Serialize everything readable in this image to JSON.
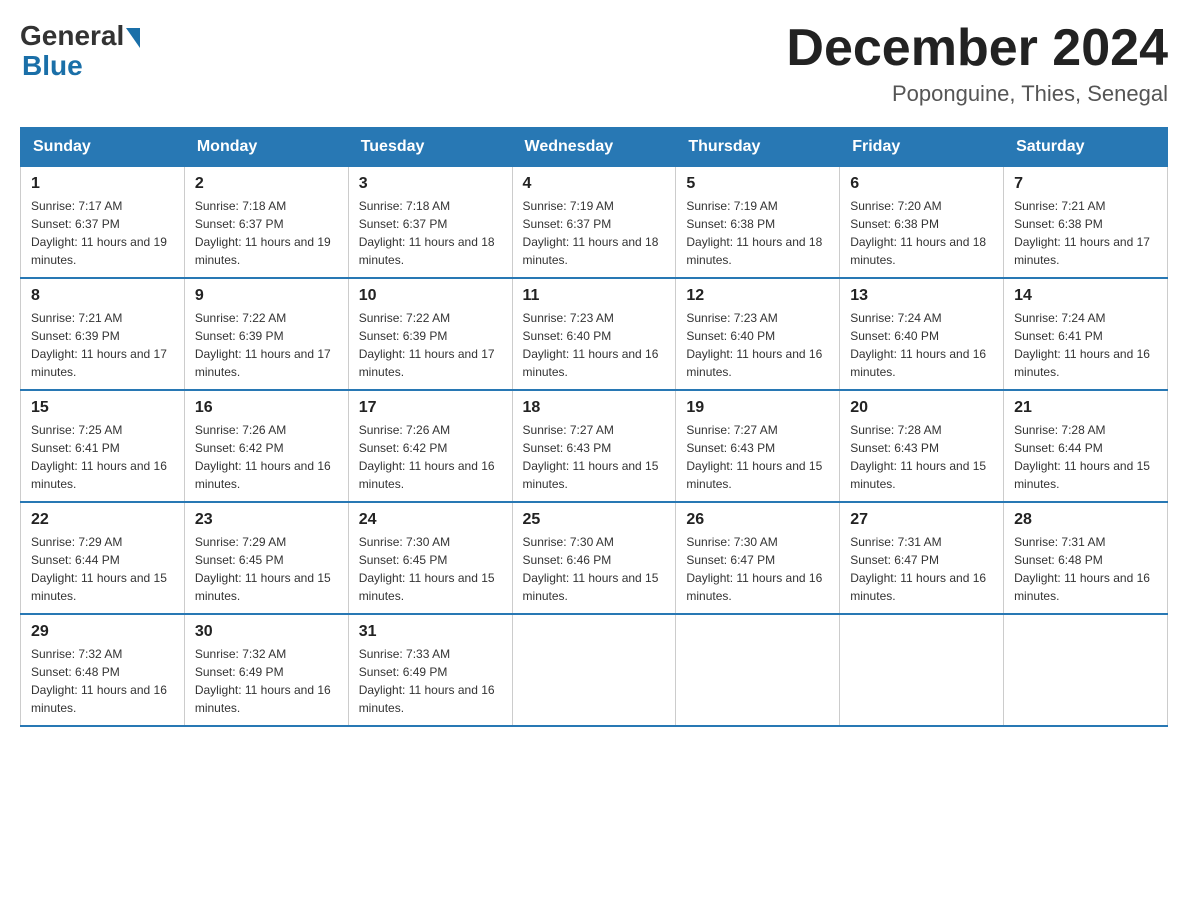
{
  "logo": {
    "general": "General",
    "blue": "Blue"
  },
  "title": "December 2024",
  "location": "Poponguine, Thies, Senegal",
  "days_header": [
    "Sunday",
    "Monday",
    "Tuesday",
    "Wednesday",
    "Thursday",
    "Friday",
    "Saturday"
  ],
  "weeks": [
    [
      {
        "day": "1",
        "sunrise": "7:17 AM",
        "sunset": "6:37 PM",
        "daylight": "11 hours and 19 minutes."
      },
      {
        "day": "2",
        "sunrise": "7:18 AM",
        "sunset": "6:37 PM",
        "daylight": "11 hours and 19 minutes."
      },
      {
        "day": "3",
        "sunrise": "7:18 AM",
        "sunset": "6:37 PM",
        "daylight": "11 hours and 18 minutes."
      },
      {
        "day": "4",
        "sunrise": "7:19 AM",
        "sunset": "6:37 PM",
        "daylight": "11 hours and 18 minutes."
      },
      {
        "day": "5",
        "sunrise": "7:19 AM",
        "sunset": "6:38 PM",
        "daylight": "11 hours and 18 minutes."
      },
      {
        "day": "6",
        "sunrise": "7:20 AM",
        "sunset": "6:38 PM",
        "daylight": "11 hours and 18 minutes."
      },
      {
        "day": "7",
        "sunrise": "7:21 AM",
        "sunset": "6:38 PM",
        "daylight": "11 hours and 17 minutes."
      }
    ],
    [
      {
        "day": "8",
        "sunrise": "7:21 AM",
        "sunset": "6:39 PM",
        "daylight": "11 hours and 17 minutes."
      },
      {
        "day": "9",
        "sunrise": "7:22 AM",
        "sunset": "6:39 PM",
        "daylight": "11 hours and 17 minutes."
      },
      {
        "day": "10",
        "sunrise": "7:22 AM",
        "sunset": "6:39 PM",
        "daylight": "11 hours and 17 minutes."
      },
      {
        "day": "11",
        "sunrise": "7:23 AM",
        "sunset": "6:40 PM",
        "daylight": "11 hours and 16 minutes."
      },
      {
        "day": "12",
        "sunrise": "7:23 AM",
        "sunset": "6:40 PM",
        "daylight": "11 hours and 16 minutes."
      },
      {
        "day": "13",
        "sunrise": "7:24 AM",
        "sunset": "6:40 PM",
        "daylight": "11 hours and 16 minutes."
      },
      {
        "day": "14",
        "sunrise": "7:24 AM",
        "sunset": "6:41 PM",
        "daylight": "11 hours and 16 minutes."
      }
    ],
    [
      {
        "day": "15",
        "sunrise": "7:25 AM",
        "sunset": "6:41 PM",
        "daylight": "11 hours and 16 minutes."
      },
      {
        "day": "16",
        "sunrise": "7:26 AM",
        "sunset": "6:42 PM",
        "daylight": "11 hours and 16 minutes."
      },
      {
        "day": "17",
        "sunrise": "7:26 AM",
        "sunset": "6:42 PM",
        "daylight": "11 hours and 16 minutes."
      },
      {
        "day": "18",
        "sunrise": "7:27 AM",
        "sunset": "6:43 PM",
        "daylight": "11 hours and 15 minutes."
      },
      {
        "day": "19",
        "sunrise": "7:27 AM",
        "sunset": "6:43 PM",
        "daylight": "11 hours and 15 minutes."
      },
      {
        "day": "20",
        "sunrise": "7:28 AM",
        "sunset": "6:43 PM",
        "daylight": "11 hours and 15 minutes."
      },
      {
        "day": "21",
        "sunrise": "7:28 AM",
        "sunset": "6:44 PM",
        "daylight": "11 hours and 15 minutes."
      }
    ],
    [
      {
        "day": "22",
        "sunrise": "7:29 AM",
        "sunset": "6:44 PM",
        "daylight": "11 hours and 15 minutes."
      },
      {
        "day": "23",
        "sunrise": "7:29 AM",
        "sunset": "6:45 PM",
        "daylight": "11 hours and 15 minutes."
      },
      {
        "day": "24",
        "sunrise": "7:30 AM",
        "sunset": "6:45 PM",
        "daylight": "11 hours and 15 minutes."
      },
      {
        "day": "25",
        "sunrise": "7:30 AM",
        "sunset": "6:46 PM",
        "daylight": "11 hours and 15 minutes."
      },
      {
        "day": "26",
        "sunrise": "7:30 AM",
        "sunset": "6:47 PM",
        "daylight": "11 hours and 16 minutes."
      },
      {
        "day": "27",
        "sunrise": "7:31 AM",
        "sunset": "6:47 PM",
        "daylight": "11 hours and 16 minutes."
      },
      {
        "day": "28",
        "sunrise": "7:31 AM",
        "sunset": "6:48 PM",
        "daylight": "11 hours and 16 minutes."
      }
    ],
    [
      {
        "day": "29",
        "sunrise": "7:32 AM",
        "sunset": "6:48 PM",
        "daylight": "11 hours and 16 minutes."
      },
      {
        "day": "30",
        "sunrise": "7:32 AM",
        "sunset": "6:49 PM",
        "daylight": "11 hours and 16 minutes."
      },
      {
        "day": "31",
        "sunrise": "7:33 AM",
        "sunset": "6:49 PM",
        "daylight": "11 hours and 16 minutes."
      },
      null,
      null,
      null,
      null
    ]
  ]
}
